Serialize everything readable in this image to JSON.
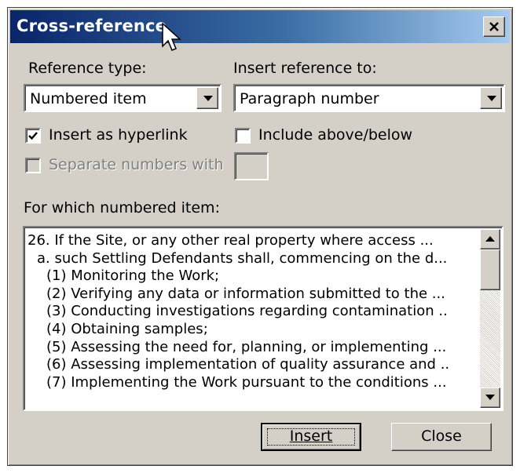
{
  "dialog": {
    "title": "Cross-reference",
    "close_icon": "close-x-icon"
  },
  "reference_type": {
    "label": "Reference type:",
    "value": "Numbered item"
  },
  "insert_reference_to": {
    "label": "Insert reference to:",
    "value": "Paragraph number"
  },
  "options": {
    "insert_as_hyperlink": {
      "label": "Insert as hyperlink",
      "checked": true
    },
    "include_above_below": {
      "label": "Include above/below",
      "checked": false
    },
    "separate_numbers_with": {
      "label": "Separate numbers with",
      "checked": false,
      "enabled": false,
      "value": ""
    }
  },
  "list": {
    "label": "For which numbered item:",
    "items": [
      "26. If the Site, or any other real property where access ...",
      "a. such Settling Defendants shall, commencing on the d...",
      "(1) Monitoring the Work;",
      "(2) Verifying any data or information submitted to the ...",
      "(3) Conducting investigations regarding contamination ..",
      "(4) Obtaining samples;",
      "(5) Assessing the need for, planning, or implementing ...",
      "(6) Assessing implementation of quality assurance and ..",
      "(7) Implementing the Work pursuant to the conditions ..."
    ]
  },
  "buttons": {
    "insert": "Insert",
    "close": "Close"
  }
}
